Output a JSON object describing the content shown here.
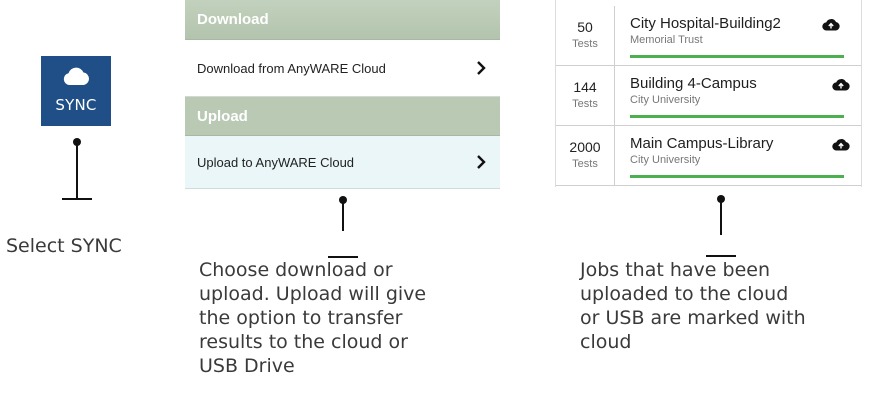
{
  "sync": {
    "label": "SYNC",
    "icon": "cloud-icon",
    "bg_color": "#1f4f86",
    "caption": "Select SYNC"
  },
  "transfer": {
    "download_header": "Download",
    "download_item": "Download from AnyWARE Cloud",
    "upload_header": "Upload",
    "upload_item": "Upload to AnyWARE Cloud",
    "header_color": "#b9c9b4",
    "caption_lines": [
      "Choose download or",
      "upload. Upload will give",
      "the option to transfer",
      "results to the cloud or",
      "USB Drive"
    ]
  },
  "jobs": {
    "items": [
      {
        "count": "50",
        "unit": "Tests",
        "name": "City Hospital-Building2",
        "org": "Memorial Trust",
        "icon": "cloud-upload-icon"
      },
      {
        "count": "144",
        "unit": "Tests",
        "name": "Building 4-Campus",
        "org": "City University",
        "icon": "cloud-upload-icon"
      },
      {
        "count": "2000",
        "unit": "Tests",
        "name": "Main Campus-Library",
        "org": "City University",
        "icon": "cloud-upload-icon"
      }
    ],
    "progress_color": "#4caf50",
    "caption_lines": [
      "Jobs that have been",
      "uploaded to the cloud",
      "or USB are marked with",
      "cloud"
    ]
  }
}
